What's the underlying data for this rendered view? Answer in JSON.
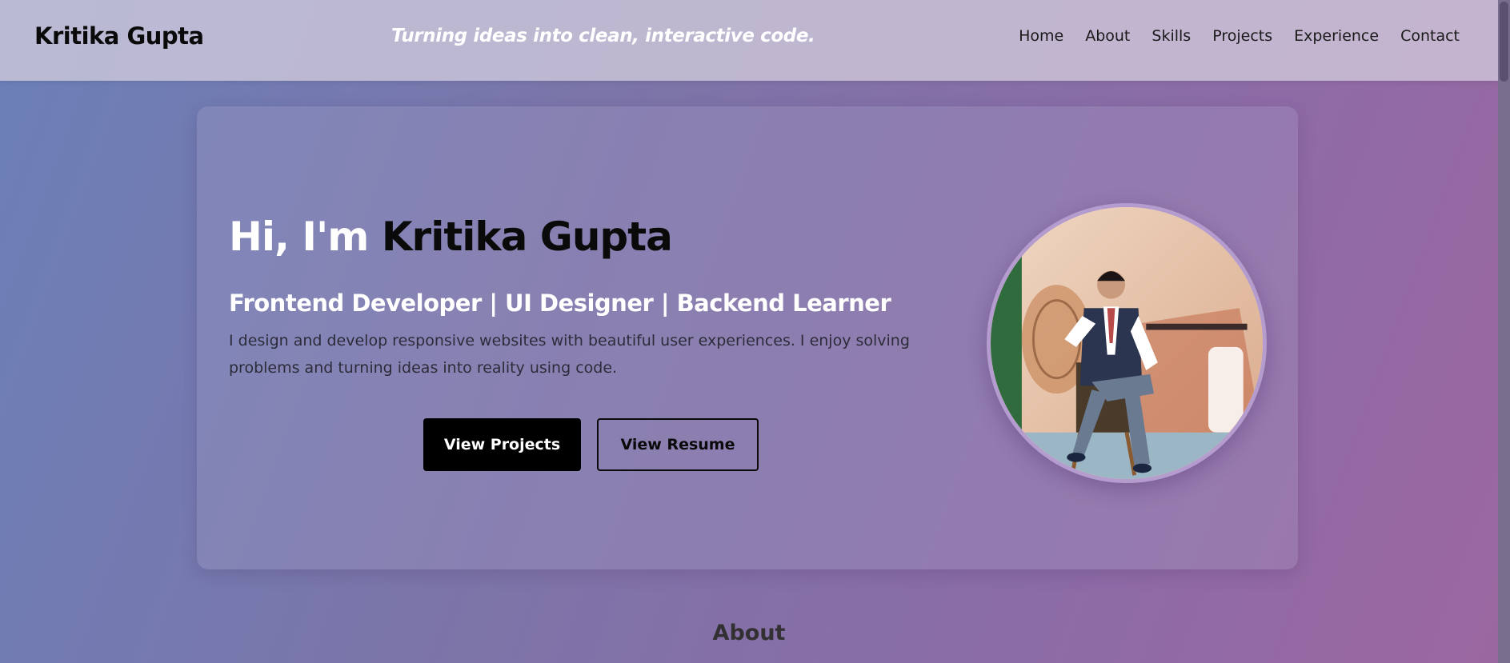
{
  "header": {
    "brand": "Kritika Gupta",
    "tagline": "Turning ideas into clean, interactive code.",
    "nav": [
      "Home",
      "About",
      "Skills",
      "Projects",
      "Experience",
      "Contact"
    ]
  },
  "hero": {
    "greeting": "Hi, I'm ",
    "name": "Kritika Gupta",
    "subtitle": "Frontend Developer | UI Designer | Backend Learner",
    "description": "I design and develop responsive websites with beautiful user experiences. I enjoy solving problems and turning ideas into reality using code.",
    "primary_button": "View Projects",
    "secondary_button": "View Resume",
    "photo_icon": "profile-photo"
  },
  "sections": {
    "about_heading": "About"
  },
  "colors": {
    "accent": "#000000",
    "avatar_ring": "#b49ccf",
    "header_bg": "#d4cede"
  }
}
